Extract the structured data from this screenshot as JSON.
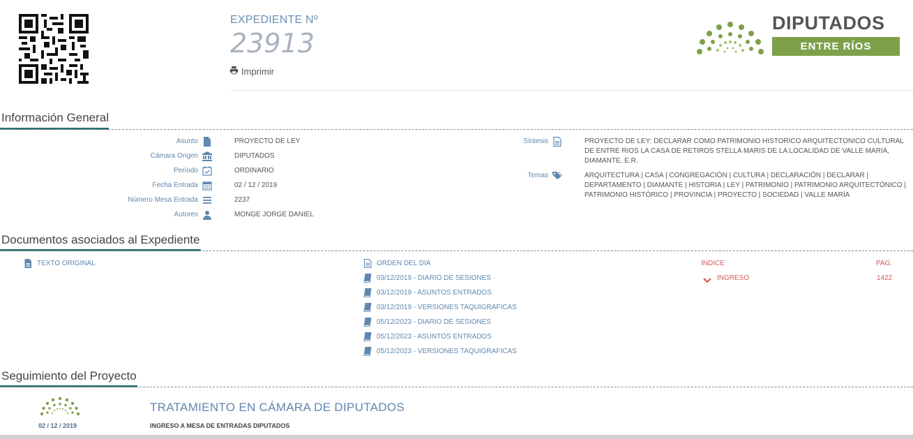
{
  "header": {
    "expediente_label": "EXPEDIENTE Nº",
    "expediente_number": "23913",
    "print_label": "Imprimir"
  },
  "logo": {
    "title": "DIPUTADOS",
    "subtitle": "ENTRE RÍOS",
    "colors": {
      "green": "#7ea04a",
      "gray": "#555555"
    }
  },
  "sections": {
    "general": "Información General",
    "documents": "Documentos asociados al Expediente",
    "tracking": "Seguimiento del Proyecto"
  },
  "general_info": {
    "left": [
      {
        "label": "Asunto",
        "icon": "file-icon",
        "value": "PROYECTO DE LEY"
      },
      {
        "label": "Cámara Origen",
        "icon": "bank-icon",
        "value": "DIPUTADOS"
      },
      {
        "label": "Período",
        "icon": "calendar-check-icon",
        "value": "ORDINARIO"
      },
      {
        "label": "Fecha Entrada",
        "icon": "calendar-icon",
        "value": "02 / 12 / 2019"
      },
      {
        "label": "Número Mesa Entrada",
        "icon": "list-icon",
        "value": "2237"
      },
      {
        "label": "Autores",
        "icon": "user-icon",
        "value": "MONGE JORGE DANIEL"
      }
    ],
    "sintesis": {
      "label": "Síntesis",
      "icon": "file-text-icon",
      "lines": [
        "PROYECTO DE LEY: DECLARAR COMO PATRIMONIO HISTORICO ARQUITECTONICO CULTURAL",
        "DE ENTRE RIOS LA CASA DE RETIROS STELLA MARIS DE LA LOCALIDAD DE VALLE MARIA,",
        "DIAMANTE, E.R."
      ]
    },
    "temas": {
      "label": "Temas",
      "icon": "tags-icon",
      "lines": [
        "ARQUITECTURA | CASA | CONGREGACIÓN | CULTURA | DECLARACIÓN | DECLARAR |",
        "DEPARTAMENTO | DIAMANTE | HISTORIA | LEY | PATRIMONIO | PATRIMONIO ARQUITECTÓNICO |",
        "PATRIMONIO HISTÓRICO | PROVINCIA | PROYECTO | SOCIEDAD | VALLE MARÍA"
      ]
    }
  },
  "documents": {
    "texto_original": "TEXTO ORIGINAL",
    "orden_del_dia": "ORDEN DEL DIA",
    "items": [
      "03/12/2019 - DIARIO DE SESIONES",
      "03/12/2019 - ASUNTOS ENTRADOS",
      "03/12/2019 - VERSIONES TAQUIGRAFICAS",
      "05/12/2023 - DIARIO DE SESIONES",
      "05/12/2023 - ASUNTOS ENTRADOS",
      "05/12/2023 - VERSIONES TAQUIGRAFICAS"
    ],
    "indice_label": "INDICE",
    "pag_label": "PAG.",
    "indice_item": "INGRESO",
    "pag_value": "1422",
    "accent_color": "#d35a5a"
  },
  "tracking": {
    "date": "02 / 12 / 2019",
    "title": "TRATAMIENTO EN CÁMARA DE DIPUTADOS",
    "subtitle": "INGRESO A MESA DE ENTRADAS DIPUTADOS"
  }
}
